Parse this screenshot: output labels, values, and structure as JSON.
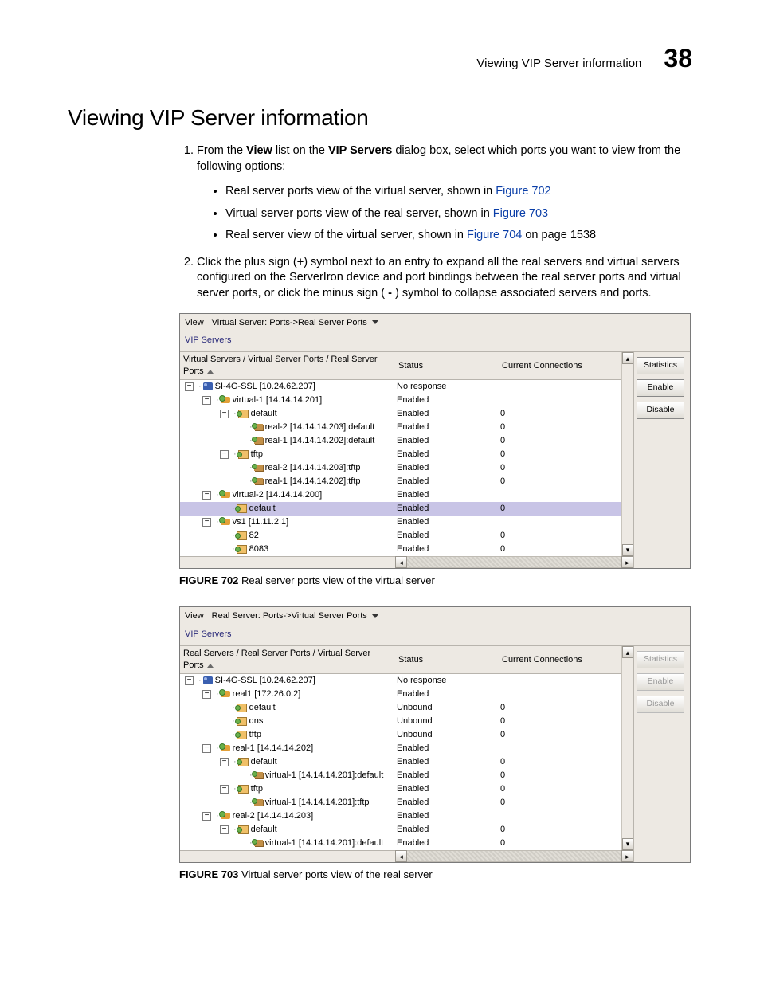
{
  "header": {
    "section": "Viewing VIP Server information",
    "chapter": "38"
  },
  "title": "Viewing VIP Server information",
  "steps": {
    "s1a": "From the ",
    "s1b": "View",
    "s1c": " list on the ",
    "s1d": "VIP Servers",
    "s1e": " dialog box, select which ports you want to view from the following options:",
    "b1a": "Real server ports view of the virtual server, shown in ",
    "b1b": "Figure 702",
    "b2a": "Virtual server ports view of the real server, shown in ",
    "b2b": "Figure 703",
    "b3a": "Real server view of the virtual server, shown in ",
    "b3b": "Figure 704",
    "b3c": " on page 1538",
    "s2a": "Click the plus sign (",
    "s2b": "+",
    "s2c": ") symbol next to an entry to expand all the real servers and virtual servers configured on the ServerIron device and port bindings between the real server ports and virtual server ports, or click the minus sign (",
    "s2d": " - ",
    "s2e": ") symbol to collapse associated servers and ports."
  },
  "captions": {
    "f702a": "FIGURE 702",
    "f702b": "   Real server ports view of the virtual server",
    "f703a": "FIGURE 703",
    "f703b": "   Virtual server ports view of the real server"
  },
  "panel_common": {
    "view_label": "View",
    "vip_title": "VIP Servers"
  },
  "panel1": {
    "combo": "Virtual Server: Ports->Real Server Ports",
    "col1": "Virtual Servers / Virtual Server Ports / Real Server Ports",
    "col2": "Status",
    "col3": "Current Connections",
    "btn_stats": "Statistics",
    "btn_enable": "Enable",
    "btn_disable": "Disable",
    "rows": [
      {
        "indent": 0,
        "exp": "-",
        "icon": "server",
        "label": "SI-4G-SSL [10.24.62.207]",
        "status": "No response",
        "conn": ""
      },
      {
        "indent": 1,
        "exp": "-",
        "icon": "vs",
        "label": "virtual-1 [14.14.14.201]",
        "status": "Enabled",
        "conn": ""
      },
      {
        "indent": 2,
        "exp": "-",
        "icon": "port",
        "label": "default",
        "status": "Enabled",
        "conn": "0"
      },
      {
        "indent": 3,
        "exp": "",
        "icon": "real",
        "label": "real-2 [14.14.14.203]:default",
        "status": "Enabled",
        "conn": "0"
      },
      {
        "indent": 3,
        "exp": "",
        "icon": "real",
        "label": "real-1 [14.14.14.202]:default",
        "status": "Enabled",
        "conn": "0"
      },
      {
        "indent": 2,
        "exp": "-",
        "icon": "port",
        "label": "tftp",
        "status": "Enabled",
        "conn": "0"
      },
      {
        "indent": 3,
        "exp": "",
        "icon": "real",
        "label": "real-2 [14.14.14.203]:tftp",
        "status": "Enabled",
        "conn": "0"
      },
      {
        "indent": 3,
        "exp": "",
        "icon": "real",
        "label": "real-1 [14.14.14.202]:tftp",
        "status": "Enabled",
        "conn": "0"
      },
      {
        "indent": 1,
        "exp": "-",
        "icon": "vs",
        "label": "virtual-2 [14.14.14.200]",
        "status": "Enabled",
        "conn": ""
      },
      {
        "indent": 2,
        "exp": "",
        "icon": "port",
        "label": "default",
        "status": "Enabled",
        "conn": "0",
        "sel": true
      },
      {
        "indent": 1,
        "exp": "-",
        "icon": "vs",
        "label": "vs1 [11.11.2.1]",
        "status": "Enabled",
        "conn": ""
      },
      {
        "indent": 2,
        "exp": "",
        "icon": "port",
        "label": "82",
        "status": "Enabled",
        "conn": "0"
      },
      {
        "indent": 2,
        "exp": "",
        "icon": "port",
        "label": "8083",
        "status": "Enabled",
        "conn": "0"
      }
    ]
  },
  "panel2": {
    "combo": "Real Server: Ports->Virtual Server Ports",
    "col1": "Real Servers / Real Server Ports / Virtual Server Ports",
    "col2": "Status",
    "col3": "Current Connections",
    "btn_stats": "Statistics",
    "btn_enable": "Enable",
    "btn_disable": "Disable",
    "rows": [
      {
        "indent": 0,
        "exp": "-",
        "icon": "server",
        "label": "SI-4G-SSL [10.24.62.207]",
        "status": "No response",
        "conn": ""
      },
      {
        "indent": 1,
        "exp": "-",
        "icon": "vs",
        "label": "real1 [172.26.0.2]",
        "status": "Enabled",
        "conn": ""
      },
      {
        "indent": 2,
        "exp": "",
        "icon": "port",
        "label": "default",
        "status": "Unbound",
        "conn": "0"
      },
      {
        "indent": 2,
        "exp": "",
        "icon": "port",
        "label": "dns",
        "status": "Unbound",
        "conn": "0"
      },
      {
        "indent": 2,
        "exp": "",
        "icon": "port",
        "label": "tftp",
        "status": "Unbound",
        "conn": "0"
      },
      {
        "indent": 1,
        "exp": "-",
        "icon": "vs",
        "label": "real-1 [14.14.14.202]",
        "status": "Enabled",
        "conn": ""
      },
      {
        "indent": 2,
        "exp": "-",
        "icon": "port",
        "label": "default",
        "status": "Enabled",
        "conn": "0"
      },
      {
        "indent": 3,
        "exp": "",
        "icon": "real",
        "label": "virtual-1 [14.14.14.201]:default",
        "status": "Enabled",
        "conn": "0"
      },
      {
        "indent": 2,
        "exp": "-",
        "icon": "port",
        "label": "tftp",
        "status": "Enabled",
        "conn": "0"
      },
      {
        "indent": 3,
        "exp": "",
        "icon": "real",
        "label": "virtual-1 [14.14.14.201]:tftp",
        "status": "Enabled",
        "conn": "0"
      },
      {
        "indent": 1,
        "exp": "-",
        "icon": "vs",
        "label": "real-2 [14.14.14.203]",
        "status": "Enabled",
        "conn": ""
      },
      {
        "indent": 2,
        "exp": "-",
        "icon": "port",
        "label": "default",
        "status": "Enabled",
        "conn": "0"
      },
      {
        "indent": 3,
        "exp": "",
        "icon": "real",
        "label": "virtual-1 [14.14.14.201]:default",
        "status": "Enabled",
        "conn": "0"
      }
    ]
  }
}
